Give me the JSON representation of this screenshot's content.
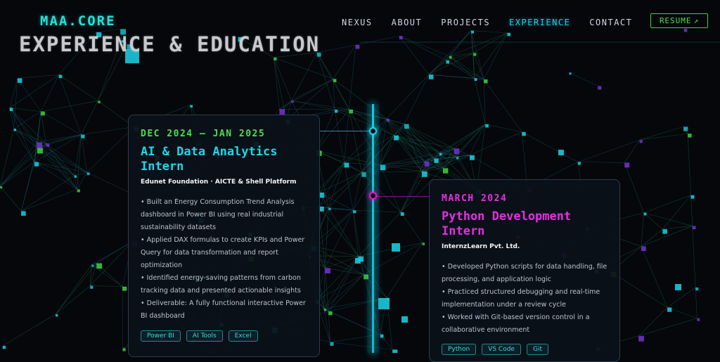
{
  "brand": {
    "logo": "MAA.CORE"
  },
  "nav": {
    "items": [
      {
        "label": "NEXUS",
        "active": false
      },
      {
        "label": "ABOUT",
        "active": false
      },
      {
        "label": "PROJECTS",
        "active": false
      },
      {
        "label": "EXPERIENCE",
        "active": true
      },
      {
        "label": "CONTACT",
        "active": false
      }
    ],
    "resume": {
      "label": "RESUME",
      "icon": "arrow-up-right-icon"
    }
  },
  "section": {
    "title": "EXPERIENCE & EDUCATION"
  },
  "experience": [
    {
      "date": "DEC 2024 – JAN 2025",
      "role": "AI & Data Analytics Intern",
      "org": "Edunet Foundation · AICTE & Shell Platform",
      "bullets": [
        "Built an Energy Consumption Trend Analysis dashboard in Power BI using real industrial sustainability datasets",
        "Applied DAX formulas to create KPIs and Power Query for data transformation and report optimization",
        "Identified energy-saving patterns from carbon tracking data and presented actionable insights",
        "Deliverable: A fully functional interactive Power BI dashboard"
      ],
      "tags": [
        "Power BI",
        "AI Tools",
        "Excel"
      ]
    },
    {
      "date": "MARCH 2024",
      "role": "Python Development Intern",
      "org": "InternzLearn Pvt. Ltd.",
      "bullets": [
        "Developed Python scripts for data handling, file processing, and application logic",
        "Practiced structured debugging and real-time implementation under a review cycle",
        "Worked with Git-based version control in a collaborative environment"
      ],
      "tags": [
        "Python",
        "VS Code",
        "Git"
      ]
    }
  ],
  "colors": {
    "background": "#05070b",
    "accent_cyan": "#1fd6ea",
    "accent_green": "#46e24a",
    "accent_magenta": "#e52ee0"
  }
}
